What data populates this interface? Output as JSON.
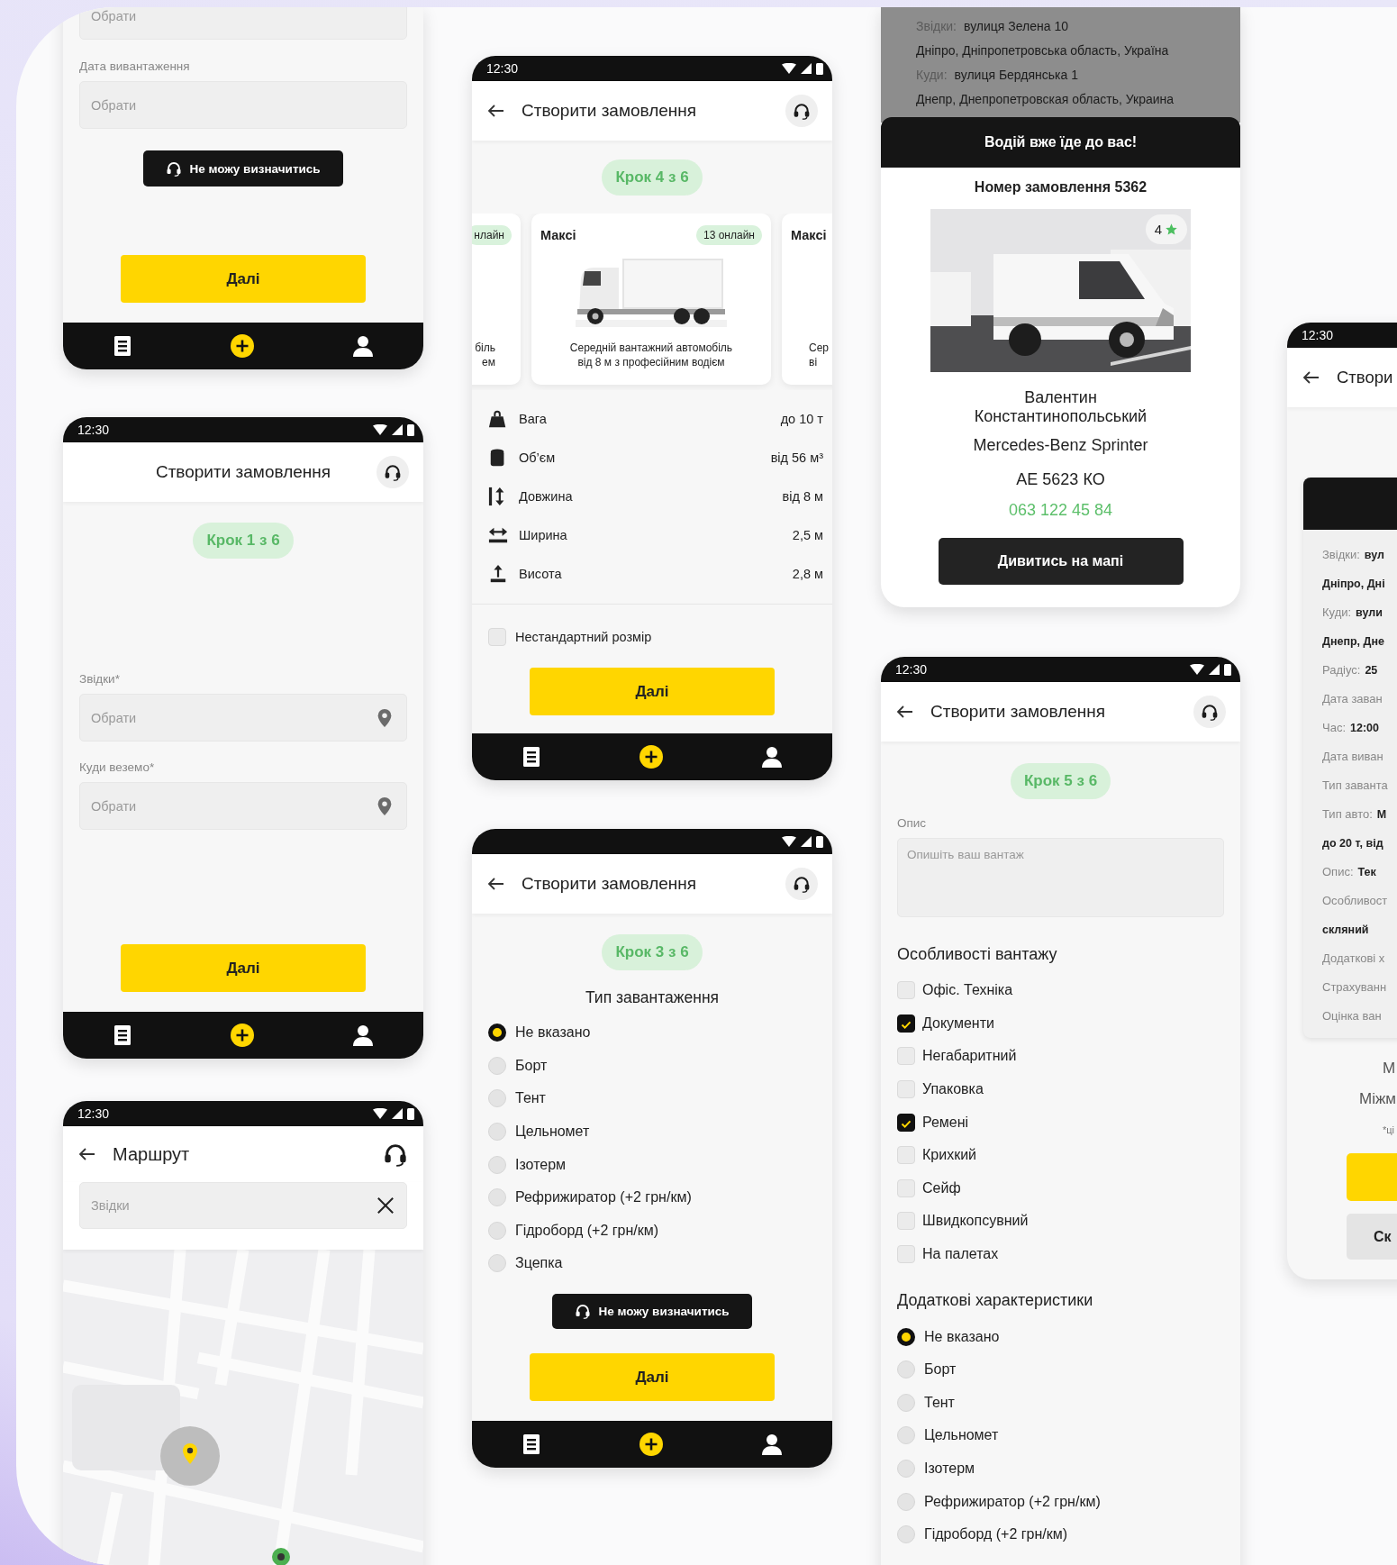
{
  "screens": [
    {
      "kind": "form",
      "blocks": [
        {
          "kind": "field",
          "placeholder": "Обрати"
        },
        {
          "kind": "field",
          "label": "Дата вивантаження",
          "placeholder": "Обрати"
        },
        {
          "kind": "help_button",
          "label": "Не можу визначитись"
        },
        {
          "kind": "next_button",
          "label": "Далі"
        }
      ],
      "nav_bar": [
        {
          "kind": "list"
        },
        {
          "kind": "add"
        },
        {
          "kind": "profile"
        }
      ]
    },
    {
      "kind": "form",
      "status_bar": {
        "time": "12:30",
        "icons": true
      },
      "header": {
        "title": "Створити замовлення",
        "back": false,
        "support": true
      },
      "blocks": [
        {
          "kind": "step",
          "label": "Крок 1 з 6"
        },
        {
          "kind": "location_field",
          "label": "Звідки*",
          "placeholder": "Обрати"
        },
        {
          "kind": "location_field",
          "label": "Куди веземо*",
          "placeholder": "Обрати"
        },
        {
          "kind": "next_button",
          "label": "Далі"
        }
      ],
      "nav_bar": [
        {
          "kind": "list"
        },
        {
          "kind": "add"
        },
        {
          "kind": "profile"
        }
      ]
    },
    {
      "kind": "route",
      "status_bar": {
        "time": "12:30",
        "icons": true
      },
      "header": {
        "title": "Маршрут",
        "back": true,
        "support": true
      },
      "blocks": [
        {
          "kind": "search",
          "placeholder": "Звідки"
        },
        {
          "kind": "map"
        }
      ]
    },
    {
      "kind": "form",
      "status_bar": {
        "time": "12:30",
        "icons": true
      },
      "header": {
        "title": "Створити замовлення",
        "back": true,
        "support": true
      },
      "blocks": [
        {
          "kind": "step",
          "label": "Крок 4 з 6"
        },
        {
          "kind": "vehicles",
          "cards": [
            {
              "badge": "нлайн",
              "lines": [
                "біль",
                "ем"
              ]
            },
            {
              "title": "Максі",
              "badge": "13 онлайн",
              "image": {
                "kind": "picture"
              },
              "lines": [
                "Середній вантажний автомобіль",
                "від 8 м з професійним водієм"
              ]
            },
            {
              "title": "Максі",
              "lines": [
                "Сер",
                "ві"
              ]
            }
          ]
        },
        {
          "kind": "specs",
          "rows": [
            {
              "label": "Вага",
              "value": "до 10 т"
            },
            {
              "label": "Об’єм",
              "value": "від 56 м³"
            },
            {
              "label": "Довжина",
              "value": "від 8 м"
            },
            {
              "label": "Ширина",
              "value": "2,5 м"
            },
            {
              "label": "Висота",
              "value": "2,8 м"
            }
          ]
        },
        {
          "kind": "checkbox",
          "label": "Нестандартний розмір",
          "checked": false
        },
        {
          "kind": "next_button",
          "label": "Далі"
        }
      ],
      "nav_bar": [
        {
          "kind": "list"
        },
        {
          "kind": "add"
        },
        {
          "kind": "profile"
        }
      ]
    },
    {
      "kind": "form",
      "status_bar": true,
      "header": {
        "title": "Створити замовлення",
        "back": true,
        "support": true
      },
      "blocks": [
        {
          "kind": "step",
          "label": "Крок 3 з 6"
        },
        {
          "kind": "title",
          "text": "Тип завантаження"
        },
        {
          "kind": "radio",
          "label": "Не вказано",
          "selected": true
        },
        {
          "kind": "radio",
          "label": "Борт",
          "selected": false
        },
        {
          "kind": "radio",
          "label": "Тент",
          "selected": false
        },
        {
          "kind": "radio",
          "label": "Цельномет",
          "selected": false
        },
        {
          "kind": "radio",
          "label": "Ізотерм",
          "selected": false
        },
        {
          "kind": "radio",
          "label": "Рефрижиратор (+2 грн/км)",
          "selected": false
        },
        {
          "kind": "radio",
          "label": "Гідроборд (+2 грн/км)",
          "selected": false
        },
        {
          "kind": "radio",
          "label": "Зцепка",
          "selected": false
        },
        {
          "kind": "help_button",
          "label": "Не можу визначитись"
        },
        {
          "kind": "next_button",
          "label": "Далі"
        }
      ],
      "nav_bar": [
        {
          "kind": "list"
        },
        {
          "kind": "add"
        },
        {
          "kind": "profile"
        }
      ]
    },
    {
      "kind": "driver",
      "blocks": [
        {
          "kind": "address_overlay",
          "lines": [
            {
              "label": "Звідки:",
              "value": "вулиця Зелена 10"
            },
            {
              "value": "Дніпро, Дніпропетровська область, Україна"
            },
            {
              "label": "Куди:",
              "value": "вулиця Бердянська 1"
            },
            {
              "value": "Днепр, Днепропетровская область, Украина"
            }
          ]
        },
        {
          "kind": "sheet_header",
          "text": "Водій вже їде до вас!"
        },
        {
          "kind": "order_number",
          "text": "Номер замовлення 5362"
        },
        {
          "rating": "4"
        },
        {
          "kind": "driver_info",
          "name": "Валентин Константинопольський",
          "car": "Mercedes-Benz Sprinter",
          "plate": "АЕ 5623 КО",
          "phone": "063 122 45 84"
        },
        {
          "kind": "dark_button",
          "label": "Дивитись на мапі"
        }
      ]
    },
    {
      "kind": "form",
      "status_bar": {
        "time": "12:30",
        "icons": true
      },
      "header": {
        "title": "Створити замовлення",
        "back": true,
        "support": true
      },
      "blocks": [
        {
          "kind": "step",
          "label": "Крок 5 з 6"
        },
        {
          "kind": "textarea",
          "label": "Опис",
          "placeholder": "Опишіть ваш вантаж"
        },
        {
          "kind": "section",
          "text": "Особливості вантажу"
        },
        {
          "kind": "checkbox",
          "label": "Офіс. Техніка",
          "checked": false
        },
        {
          "kind": "checkbox",
          "label": "Документи",
          "checked": true
        },
        {
          "kind": "checkbox",
          "label": "Негабаритний",
          "checked": false
        },
        {
          "kind": "checkbox",
          "label": "Упаковка",
          "checked": false
        },
        {
          "kind": "checkbox",
          "label": "Ремені",
          "checked": true
        },
        {
          "kind": "checkbox",
          "label": "Крихкий",
          "checked": false
        },
        {
          "kind": "checkbox",
          "label": "Сейф",
          "checked": false
        },
        {
          "kind": "checkbox",
          "label": "Швидкопсувний",
          "checked": false
        },
        {
          "kind": "checkbox",
          "label": "На палетах",
          "checked": false
        },
        {
          "kind": "section",
          "text": "Додаткові характеристики"
        },
        {
          "kind": "radio",
          "label": "Не вказано",
          "selected": true
        },
        {
          "kind": "radio",
          "label": "Борт",
          "selected": false
        },
        {
          "kind": "radio",
          "label": "Тент",
          "selected": false
        },
        {
          "kind": "radio",
          "label": "Цельномет",
          "selected": false
        },
        {
          "kind": "radio",
          "label": "Ізотерм",
          "selected": false
        },
        {
          "kind": "radio",
          "label": "Рефрижиратор (+2 грн/км)",
          "selected": false
        },
        {
          "kind": "radio",
          "label": "Гідроборд (+2 грн/км)",
          "selected": false
        }
      ]
    },
    {
      "kind": "summary",
      "status_bar": {
        "time": "12:30",
        "icons": false
      },
      "header": {
        "title": "Створи",
        "back": true,
        "support": false
      },
      "blocks": [
        {
          "kind": "summary_card",
          "rows": [
            {
              "label": "Звідки:",
              "value": "вул"
            },
            {
              "value": "Дніпро, Дні"
            },
            {
              "label": "Куди:",
              "value": "вули"
            },
            {
              "value": "Днепр, Дне"
            },
            {
              "label": "Радіус:",
              "value": "25"
            },
            {
              "label": "Дата заван"
            },
            {
              "label": "Час:",
              "value": "12:00"
            },
            {
              "label": "Дата виван"
            },
            {
              "label": "Тип заванта"
            },
            {
              "label": "Тип авто:",
              "value": "М"
            },
            {
              "value": "до 20 т, від"
            },
            {
              "label": "Опис:",
              "value": "Тек"
            },
            {
              "label": "Особливост"
            },
            {
              "value": "скляний"
            },
            {
              "label": "Додаткові х"
            },
            {
              "label": "Страхуванн"
            },
            {
              "label": "Оцінка ван"
            }
          ]
        },
        {
          "kind": "note",
          "text": "М"
        },
        {
          "kind": "note",
          "text": "Міжм"
        },
        {
          "kind": "footnote",
          "text": "*ці"
        },
        {
          "kind": "primary_button"
        },
        {
          "kind": "secondary_button",
          "label": "Ск"
        }
      ]
    }
  ]
}
